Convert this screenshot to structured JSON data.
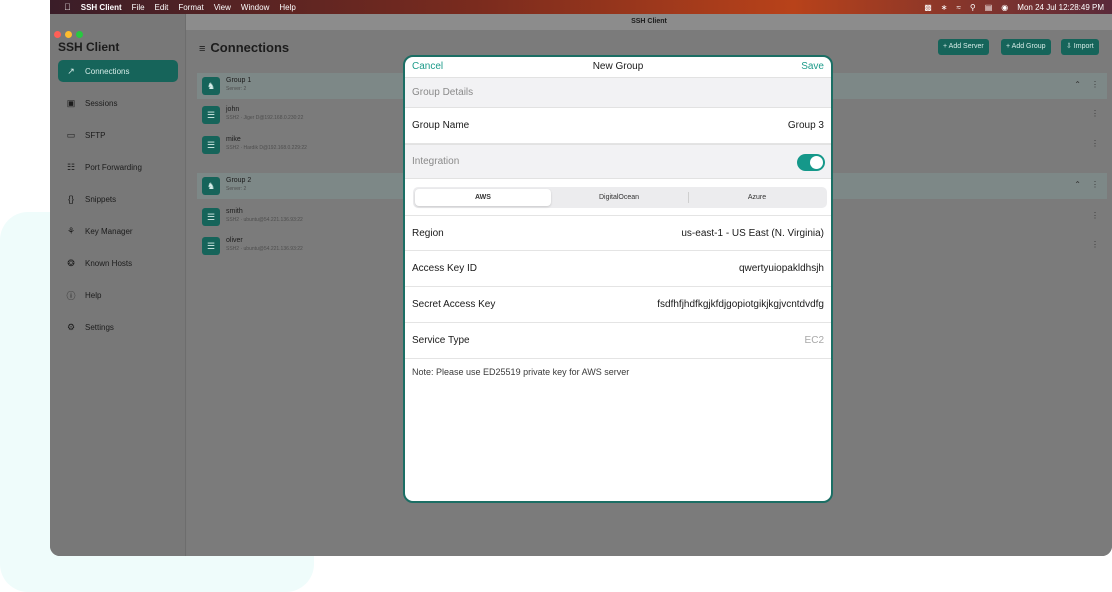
{
  "menubar": {
    "app": "SSH Client",
    "items": [
      "File",
      "Edit",
      "Format",
      "View",
      "Window",
      "Help"
    ],
    "clock": "Mon 24 Jul  12:28:49 PM"
  },
  "window": {
    "title": "SSH Client"
  },
  "sidebar": {
    "title": "SSH Client",
    "items": [
      {
        "label": "Connections",
        "icon": "connections-icon",
        "glyph": "↗"
      },
      {
        "label": "Sessions",
        "icon": "sessions-icon",
        "glyph": "▣"
      },
      {
        "label": "SFTP",
        "icon": "folder-icon",
        "glyph": "▭"
      },
      {
        "label": "Port Forwarding",
        "icon": "network-icon",
        "glyph": "☷"
      },
      {
        "label": "Snippets",
        "icon": "braces-icon",
        "glyph": "{}"
      },
      {
        "label": "Key Manager",
        "icon": "key-icon",
        "glyph": "⚘"
      },
      {
        "label": "Known Hosts",
        "icon": "known-hosts-icon",
        "glyph": "❂"
      },
      {
        "label": "Help",
        "icon": "help-icon",
        "glyph": "ⓘ"
      },
      {
        "label": "Settings",
        "icon": "gear-icon",
        "glyph": "⚙"
      }
    ]
  },
  "main": {
    "title": "Connections",
    "buttons": {
      "add_server": "+ Add Server",
      "add_group": "+ Add Group",
      "import": "⇩ Import"
    },
    "groups": [
      {
        "name": "Group 1",
        "sub": "Server: 2",
        "servers": [
          {
            "name": "john",
            "detail": "SSH2 · Jiger D@192.168.0.230:22"
          },
          {
            "name": "mike",
            "detail": "SSH2 · Hardik D@192.168.0.229:22"
          }
        ]
      },
      {
        "name": "Group 2",
        "sub": "Server: 2",
        "servers": [
          {
            "name": "smith",
            "detail": "SSH2 · ubuntu@54.221.136.93:22"
          },
          {
            "name": "oliver",
            "detail": "SSH2 · ubuntu@54.221.136.93:22"
          }
        ]
      }
    ]
  },
  "modal": {
    "cancel": "Cancel",
    "title": "New Group",
    "save": "Save",
    "section_details": "Group Details",
    "group_name_label": "Group Name",
    "group_name_value": "Group 3",
    "section_integration": "Integration",
    "integration_on": true,
    "providers": [
      "AWS",
      "DigitalOcean",
      "Azure"
    ],
    "selected_provider": "AWS",
    "region_label": "Region",
    "region_value": "us-east-1 - US East (N. Virginia)",
    "access_key_label": "Access Key ID",
    "access_key_value": "qwertyuiopakldhsjh",
    "secret_label": "Secret Access Key",
    "secret_value": "fsdfhfjhdfkgjkfdjgopiotgikjkgjvcntdvdfg",
    "service_label": "Service Type",
    "service_value": "EC2",
    "note": "Note: Please use ED25519 private key for AWS server"
  },
  "colors": {
    "accent": "#16645a",
    "link": "#1d9b8a",
    "toggle": "#15988a"
  }
}
